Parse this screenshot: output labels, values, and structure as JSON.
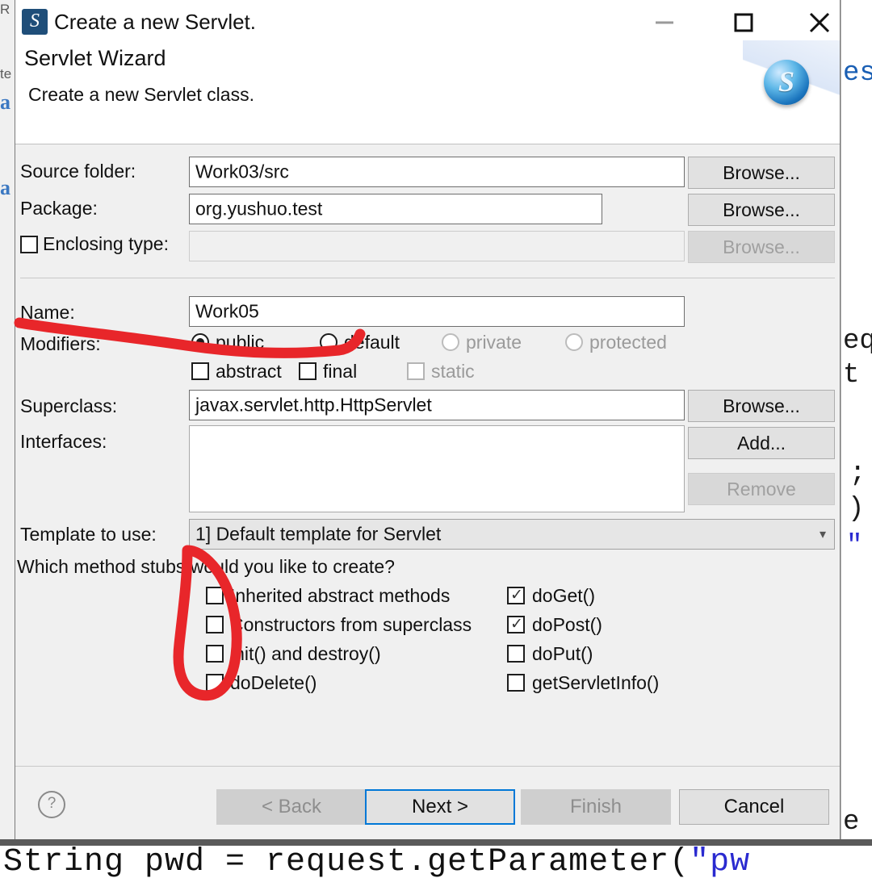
{
  "window": {
    "title": "Create a new Servlet.",
    "icon": "servlet-app-icon",
    "minimize": "minimize-icon",
    "maximize": "maximize-icon",
    "close": "close-icon"
  },
  "banner": {
    "title": "Servlet Wizard",
    "subtitle": "Create a new Servlet class.",
    "orb_glyph": "S",
    "app_glyph": "S"
  },
  "form": {
    "source_folder": {
      "label": "Source folder:",
      "value": "Work03/src",
      "browse": "Browse..."
    },
    "package": {
      "label": "Package:",
      "value": "org.yushuo.test",
      "browse": "Browse..."
    },
    "enclosing_type": {
      "label": "Enclosing type:",
      "value": "",
      "checked": false,
      "browse": "Browse..."
    },
    "name": {
      "label": "Name:",
      "value": "Work05"
    },
    "modifiers": {
      "label": "Modifiers:",
      "radios": [
        {
          "label": "public",
          "selected": true,
          "enabled": true
        },
        {
          "label": "default",
          "selected": false,
          "enabled": true
        },
        {
          "label": "private",
          "selected": false,
          "enabled": false
        },
        {
          "label": "protected",
          "selected": false,
          "enabled": false
        }
      ],
      "checks": [
        {
          "label": "abstract",
          "checked": false,
          "enabled": true
        },
        {
          "label": "final",
          "checked": false,
          "enabled": true
        },
        {
          "label": "static",
          "checked": false,
          "enabled": false
        }
      ]
    },
    "superclass": {
      "label": "Superclass:",
      "value": "javax.servlet.http.HttpServlet",
      "browse": "Browse..."
    },
    "interfaces": {
      "label": "Interfaces:",
      "value": "",
      "add": "Add...",
      "remove": "Remove"
    },
    "template": {
      "label": "Template to use:",
      "value": "1] Default template for Servlet"
    },
    "stubs": {
      "question": "Which method stubs would you like to create?",
      "left": [
        {
          "label": "Inherited abstract methods",
          "checked": false
        },
        {
          "label": "Constructors from superclass",
          "checked": false
        },
        {
          "label": "init() and destroy()",
          "checked": false
        },
        {
          "label": "doDelete()",
          "checked": false
        }
      ],
      "right": [
        {
          "label": "doGet()",
          "checked": true
        },
        {
          "label": "doPost()",
          "checked": true
        },
        {
          "label": "doPut()",
          "checked": false
        },
        {
          "label": "getServletInfo()",
          "checked": false
        }
      ]
    }
  },
  "footer": {
    "help": "?",
    "back": "< Back",
    "next": "Next >",
    "finish": "Finish",
    "cancel": "Cancel"
  },
  "annotations": {
    "ink_color": "#e8262a",
    "underline_name_modifiers": "red-underline-stroke",
    "circle_method_stubs": "red-circle-stroke"
  },
  "background": {
    "code_line": "String pwd = request.getParameter(",
    "code_string": "\"pw",
    "right_fragments": [
      "est",
      "eq",
      "t",
      ";",
      ")",
      "\"",
      "e"
    ],
    "left_fragments": [
      "R",
      "te",
      "a",
      "a"
    ],
    "watermark": ""
  }
}
